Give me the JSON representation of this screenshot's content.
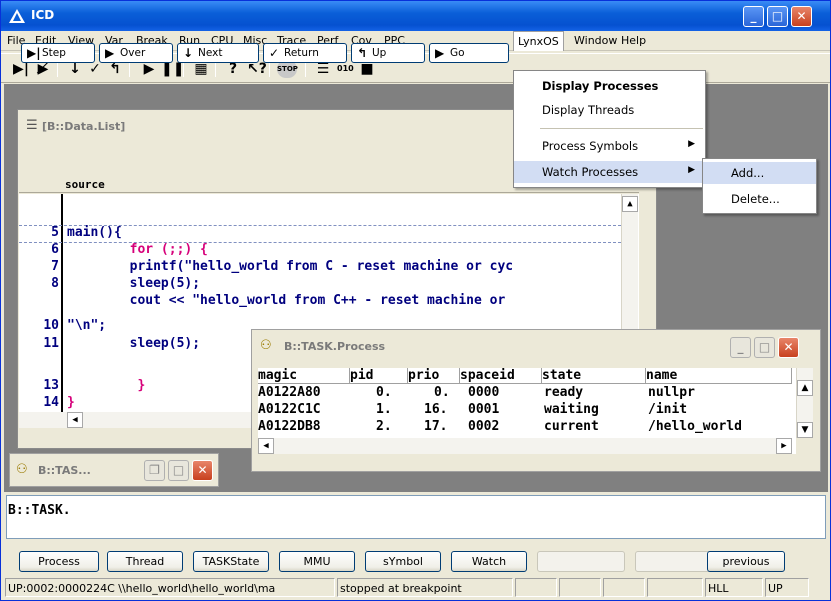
{
  "window": {
    "title": "ICD"
  },
  "menubar": {
    "items": [
      "File",
      "Edit",
      "View",
      "Var",
      "Break",
      "Run",
      "CPU",
      "Misc",
      "Trace",
      "Perf",
      "Cov",
      "PPC",
      "LynxOS",
      "Window",
      "Help"
    ]
  },
  "lynxos_menu": {
    "items": [
      {
        "label": "Display Processes",
        "bold": true
      },
      {
        "label": "Display Threads"
      },
      {
        "label": "Process Symbols",
        "submenu": true
      },
      {
        "label": "Watch Processes",
        "submenu": true,
        "highlighted": true
      }
    ]
  },
  "watch_submenu": {
    "items": [
      "Add...",
      "Delete..."
    ]
  },
  "datalist": {
    "title": "[B::Data.List]",
    "buttons": [
      "Step",
      "Over",
      "Next",
      "Return",
      "Up",
      "Go"
    ],
    "header": "source",
    "lines": [
      {
        "num": "",
        "code": ""
      },
      {
        "num": "5",
        "code": "main(){"
      },
      {
        "num": "6",
        "code": "        for (;;) {"
      },
      {
        "num": "7",
        "code": "        printf(\"hello_world from C - reset machine or cyc"
      },
      {
        "num": "8",
        "code": "        sleep(5);"
      },
      {
        "num": "",
        "code": "        cout << \"hello_world from C++ - reset machine or"
      },
      {
        "num": "10",
        "code": "\"\\n\";"
      },
      {
        "num": "11",
        "code": "        sleep(5);"
      },
      {
        "num": "",
        "code": ""
      },
      {
        "num": "13",
        "code": "         }"
      },
      {
        "num": "14",
        "code": "}"
      }
    ]
  },
  "taskwin": {
    "title": "B::TASK.Process",
    "columns": [
      "magic",
      "pid",
      "prio",
      "spaceid",
      "state",
      "name"
    ],
    "rows": [
      [
        "A0122A80",
        "0.",
        "0.",
        "0000",
        "ready",
        "nullpr"
      ],
      [
        "A0122C1C",
        "1.",
        "16.",
        "0001",
        "waiting",
        "/init"
      ],
      [
        "A0122DB8",
        "2.",
        "17.",
        "0002",
        "current",
        "/hello_world"
      ]
    ]
  },
  "minwin": {
    "title": "B::TAS..."
  },
  "command": {
    "text": "B::TASK."
  },
  "bottom_buttons": [
    "Process",
    "Thread",
    "TASKState",
    "MMU",
    "sYmbol",
    "Watch",
    "",
    "",
    "previous"
  ],
  "statusbar": {
    "address": "UP:0002:0000224C  \\\\hello_world\\hello_world\\ma",
    "state": "stopped at breakpoint",
    "mode": "HLL",
    "level": "UP"
  },
  "colors": {
    "title_blue": "#0a5fd8",
    "menu_highlight": "#316ac5",
    "code_text": "#00007f",
    "keyword": "#d6007a"
  }
}
